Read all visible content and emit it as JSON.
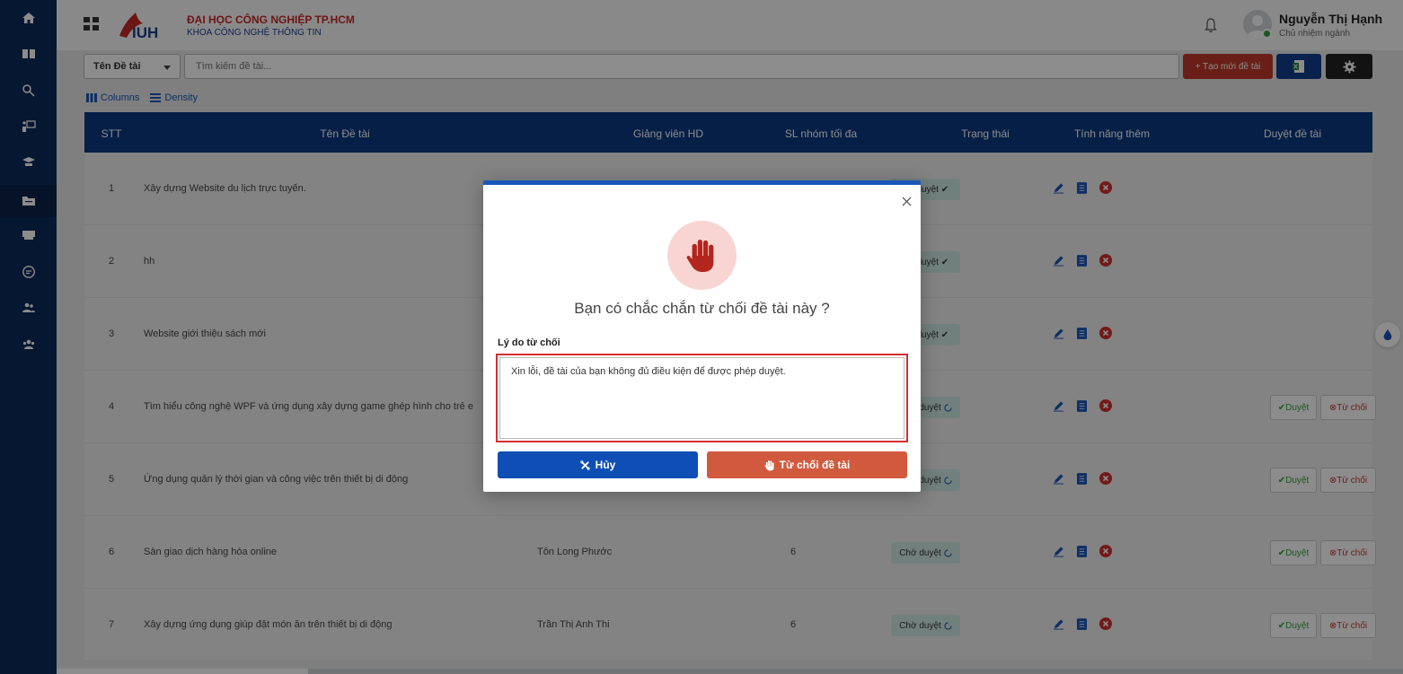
{
  "header": {
    "university_name": "ĐẠI HỌC CÔNG NGHIỆP TP.HCM",
    "faculty_name": "KHOA CÔNG NGHỆ THÔNG TIN",
    "logo_text": "IUH",
    "user_name": "Nguyễn Thị Hạnh",
    "user_role": "Chủ nhiệm ngành"
  },
  "sidebar": {
    "items": [
      {
        "icon": "home-icon"
      },
      {
        "icon": "book-icon"
      },
      {
        "icon": "search-key-icon"
      },
      {
        "icon": "presentation-icon"
      },
      {
        "icon": "graduate-icon"
      },
      {
        "icon": "folder-icon",
        "active": true
      },
      {
        "icon": "chat-icon"
      },
      {
        "icon": "message-icon"
      },
      {
        "icon": "group-icon"
      },
      {
        "icon": "team-icon"
      }
    ]
  },
  "toolbar": {
    "filter_selected": "Tên Đề tài",
    "search_placeholder": "Tìm kiếm đề tài...",
    "create_label": "+ Tạo mới đề tài",
    "columns_label": "Columns",
    "density_label": "Density"
  },
  "table": {
    "headers": [
      "STT",
      "Tên Đề tài",
      "Giảng viên HD",
      "SL nhóm tối đa",
      "Trạng thái",
      "Tính năng thêm",
      "Duyệt đề tài"
    ],
    "rows": [
      {
        "stt": "1",
        "title": "Xây dựng Website du lịch trực tuyến.",
        "lecturer": "",
        "max_groups": "",
        "status": "Đã duyệt ✔",
        "approvable": false
      },
      {
        "stt": "2",
        "title": "hh",
        "lecturer": "",
        "max_groups": "",
        "status": "Đã duyệt ✔",
        "approvable": false
      },
      {
        "stt": "3",
        "title": "Website giới thiệu sách mới",
        "lecturer": "",
        "max_groups": "",
        "status": "Đã duyệt ✔",
        "approvable": false
      },
      {
        "stt": "4",
        "title": "Tìm hiểu công nghệ WPF và ứng dụng xây dựng game ghép hình cho trẻ e",
        "lecturer": "",
        "max_groups": "",
        "status": "Chờ duyệt",
        "approvable": true
      },
      {
        "stt": "5",
        "title": "Ứng dụng quản lý thời gian và công việc trên thiết bị di động",
        "lecturer": "",
        "max_groups": "",
        "status": "Chờ duyệt",
        "approvable": true
      },
      {
        "stt": "6",
        "title": "Sàn giao dịch hàng hóa online",
        "lecturer": "Tôn Long Phước",
        "max_groups": "6",
        "status": "Chờ duyệt",
        "approvable": true
      },
      {
        "stt": "7",
        "title": "Xây dựng ứng dụng giúp đặt món ăn trên thiết bị di động",
        "lecturer": "Trần Thị Anh Thi",
        "max_groups": "6",
        "status": "Chờ duyệt",
        "approvable": true
      }
    ],
    "approve_label": "Duyệt",
    "reject_label": "Từ chối"
  },
  "modal": {
    "title": "Bạn có chắc chắn từ chối đề tài này ?",
    "reason_label": "Lý do từ chối",
    "reason_value": "Xin lỗi, đề tài của bạn không đủ điều kiện để được phép duyệt.",
    "cancel_label": "Hủy",
    "confirm_label": "Từ chối đề tài"
  },
  "colors": {
    "sidebar": "#0b2a5b",
    "table_header": "#0b3a82",
    "primary": "#0f4fb5",
    "danger": "#d15a3e",
    "highlight": "#d32f2f"
  }
}
